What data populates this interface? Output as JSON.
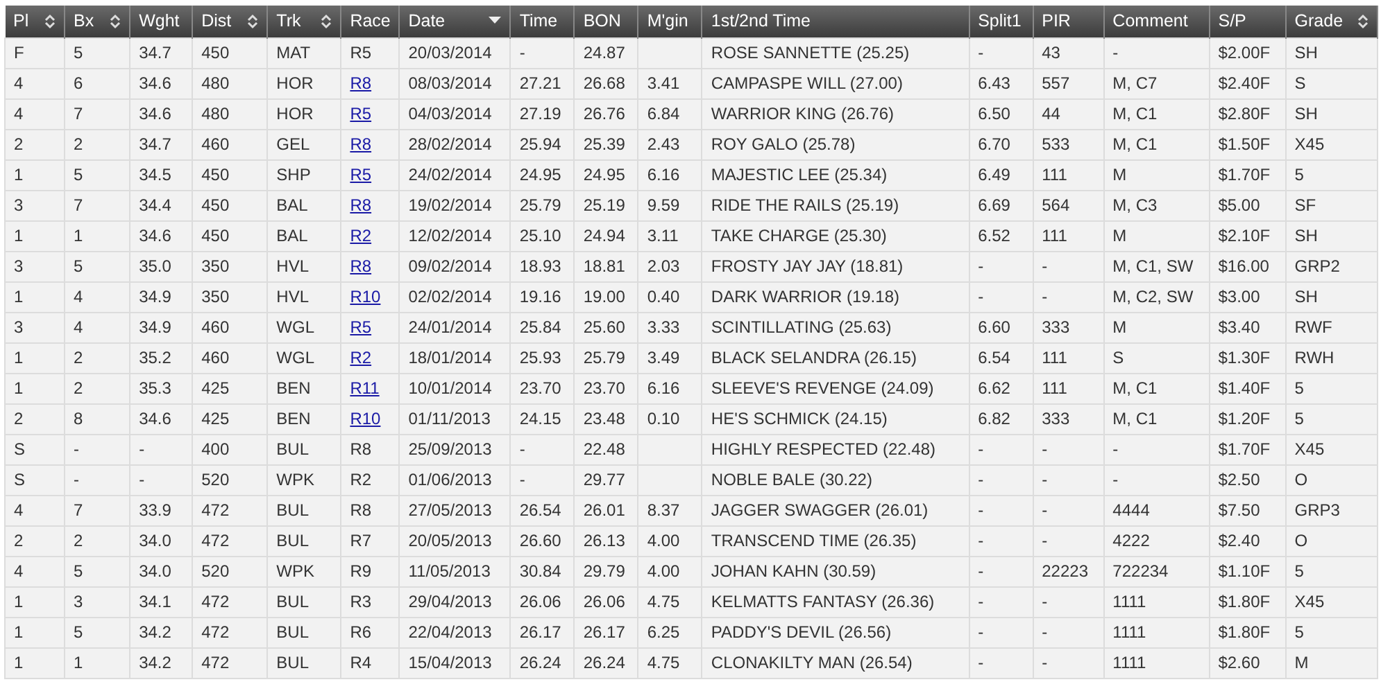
{
  "table": {
    "columns": [
      {
        "label": "Pl",
        "kind": "sortable"
      },
      {
        "label": "Bx",
        "kind": "sortable"
      },
      {
        "label": "Wght",
        "kind": "plain"
      },
      {
        "label": "Dist",
        "kind": "sortable"
      },
      {
        "label": "Trk",
        "kind": "sortable"
      },
      {
        "label": "Race",
        "kind": "plain"
      },
      {
        "label": "Date",
        "kind": "sorted"
      },
      {
        "label": "Time",
        "kind": "plain"
      },
      {
        "label": "BON",
        "kind": "plain"
      },
      {
        "label": "M'gin",
        "kind": "plain"
      },
      {
        "label": "1st/2nd Time",
        "kind": "plain"
      },
      {
        "label": "Split1",
        "kind": "plain"
      },
      {
        "label": "PIR",
        "kind": "plain"
      },
      {
        "label": "Comment",
        "kind": "plain"
      },
      {
        "label": "S/P",
        "kind": "plain"
      },
      {
        "label": "Grade",
        "kind": "sortable"
      }
    ],
    "rows": [
      {
        "race_link": false,
        "cells": [
          "F",
          "5",
          "34.7",
          "450",
          "MAT",
          "R5",
          "20/03/2014",
          "-",
          "24.87",
          "",
          "ROSE SANNETTE (25.25)",
          "-",
          "43",
          "-",
          "$2.00F",
          "SH"
        ]
      },
      {
        "race_link": true,
        "cells": [
          "4",
          "6",
          "34.6",
          "480",
          "HOR",
          "R8",
          "08/03/2014",
          "27.21",
          "26.68",
          "3.41",
          "CAMPASPE WILL (27.00)",
          "6.43",
          "557",
          "M, C7",
          "$2.40F",
          "S"
        ]
      },
      {
        "race_link": true,
        "cells": [
          "4",
          "7",
          "34.6",
          "480",
          "HOR",
          "R5",
          "04/03/2014",
          "27.19",
          "26.76",
          "6.84",
          "WARRIOR KING (26.76)",
          "6.50",
          "44",
          "M, C1",
          "$2.80F",
          "SH"
        ]
      },
      {
        "race_link": true,
        "cells": [
          "2",
          "2",
          "34.7",
          "460",
          "GEL",
          "R8",
          "28/02/2014",
          "25.94",
          "25.39",
          "2.43",
          "ROY GALO (25.78)",
          "6.70",
          "533",
          "M, C1",
          "$1.50F",
          "X45"
        ]
      },
      {
        "race_link": true,
        "cells": [
          "1",
          "5",
          "34.5",
          "450",
          "SHP",
          "R5",
          "24/02/2014",
          "24.95",
          "24.95",
          "6.16",
          "MAJESTIC LEE (25.34)",
          "6.49",
          "111",
          "M",
          "$1.70F",
          "5"
        ]
      },
      {
        "race_link": true,
        "cells": [
          "3",
          "7",
          "34.4",
          "450",
          "BAL",
          "R8",
          "19/02/2014",
          "25.79",
          "25.19",
          "9.59",
          "RIDE THE RAILS (25.19)",
          "6.69",
          "564",
          "M, C3",
          "$5.00",
          "SF"
        ]
      },
      {
        "race_link": true,
        "cells": [
          "1",
          "1",
          "34.6",
          "450",
          "BAL",
          "R2",
          "12/02/2014",
          "25.10",
          "24.94",
          "3.11",
          "TAKE CHARGE (25.30)",
          "6.52",
          "111",
          "M",
          "$2.10F",
          "SH"
        ]
      },
      {
        "race_link": true,
        "cells": [
          "3",
          "5",
          "35.0",
          "350",
          "HVL",
          "R8",
          "09/02/2014",
          "18.93",
          "18.81",
          "2.03",
          "FROSTY JAY JAY (18.81)",
          "-",
          "-",
          "M, C1, SW",
          "$16.00",
          "GRP2"
        ]
      },
      {
        "race_link": true,
        "cells": [
          "1",
          "4",
          "34.9",
          "350",
          "HVL",
          "R10",
          "02/02/2014",
          "19.16",
          "19.00",
          "0.40",
          "DARK WARRIOR (19.18)",
          "-",
          "-",
          "M, C2, SW",
          "$3.00",
          "SH"
        ]
      },
      {
        "race_link": true,
        "cells": [
          "3",
          "4",
          "34.9",
          "460",
          "WGL",
          "R5",
          "24/01/2014",
          "25.84",
          "25.60",
          "3.33",
          "SCINTILLATING (25.63)",
          "6.60",
          "333",
          "M",
          "$3.40",
          "RWF"
        ]
      },
      {
        "race_link": true,
        "cells": [
          "1",
          "2",
          "35.2",
          "460",
          "WGL",
          "R2",
          "18/01/2014",
          "25.93",
          "25.79",
          "3.49",
          "BLACK SELANDRA (26.15)",
          "6.54",
          "111",
          "S",
          "$1.30F",
          "RWH"
        ]
      },
      {
        "race_link": true,
        "cells": [
          "1",
          "2",
          "35.3",
          "425",
          "BEN",
          "R11",
          "10/01/2014",
          "23.70",
          "23.70",
          "6.16",
          "SLEEVE'S REVENGE (24.09)",
          "6.62",
          "111",
          "M, C1",
          "$1.40F",
          "5"
        ]
      },
      {
        "race_link": true,
        "cells": [
          "2",
          "8",
          "34.6",
          "425",
          "BEN",
          "R10",
          "01/11/2013",
          "24.15",
          "23.48",
          "0.10",
          "HE'S SCHMICK (24.15)",
          "6.82",
          "333",
          "M, C1",
          "$1.20F",
          "5"
        ]
      },
      {
        "race_link": false,
        "cells": [
          "S",
          "-",
          "-",
          "400",
          "BUL",
          "R8",
          "25/09/2013",
          "-",
          "22.48",
          "",
          "HIGHLY RESPECTED (22.48)",
          "-",
          "-",
          "-",
          "$1.70F",
          "X45"
        ]
      },
      {
        "race_link": false,
        "cells": [
          "S",
          "-",
          "-",
          "520",
          "WPK",
          "R2",
          "01/06/2013",
          "-",
          "29.77",
          "",
          "NOBLE BALE (30.22)",
          "-",
          "-",
          "-",
          "$2.50",
          "O"
        ]
      },
      {
        "race_link": false,
        "cells": [
          "4",
          "7",
          "33.9",
          "472",
          "BUL",
          "R8",
          "27/05/2013",
          "26.54",
          "26.01",
          "8.37",
          "JAGGER SWAGGER (26.01)",
          "-",
          "-",
          "4444",
          "$7.50",
          "GRP3"
        ]
      },
      {
        "race_link": false,
        "cells": [
          "2",
          "2",
          "34.0",
          "472",
          "BUL",
          "R7",
          "20/05/2013",
          "26.60",
          "26.13",
          "4.00",
          "TRANSCEND TIME (26.35)",
          "-",
          "-",
          "4222",
          "$2.40",
          "O"
        ]
      },
      {
        "race_link": false,
        "cells": [
          "4",
          "5",
          "34.0",
          "520",
          "WPK",
          "R9",
          "11/05/2013",
          "30.84",
          "29.79",
          "4.00",
          "JOHAN KAHN (30.59)",
          "-",
          "22223",
          "722234",
          "$1.10F",
          "5"
        ]
      },
      {
        "race_link": false,
        "cells": [
          "1",
          "3",
          "34.1",
          "472",
          "BUL",
          "R3",
          "29/04/2013",
          "26.06",
          "26.06",
          "4.75",
          "KELMATTS FANTASY (26.36)",
          "-",
          "-",
          "1111",
          "$1.80F",
          "X45"
        ]
      },
      {
        "race_link": false,
        "cells": [
          "1",
          "5",
          "34.2",
          "472",
          "BUL",
          "R6",
          "22/04/2013",
          "26.17",
          "26.17",
          "6.25",
          "PADDY'S DEVIL (26.56)",
          "-",
          "-",
          "1111",
          "$1.80F",
          "5"
        ]
      },
      {
        "race_link": false,
        "cells": [
          "1",
          "1",
          "34.2",
          "472",
          "BUL",
          "R4",
          "15/04/2013",
          "26.24",
          "26.24",
          "4.75",
          "CLONAKILTY MAN (26.54)",
          "-",
          "-",
          "1111",
          "$2.60",
          "M"
        ]
      }
    ]
  }
}
